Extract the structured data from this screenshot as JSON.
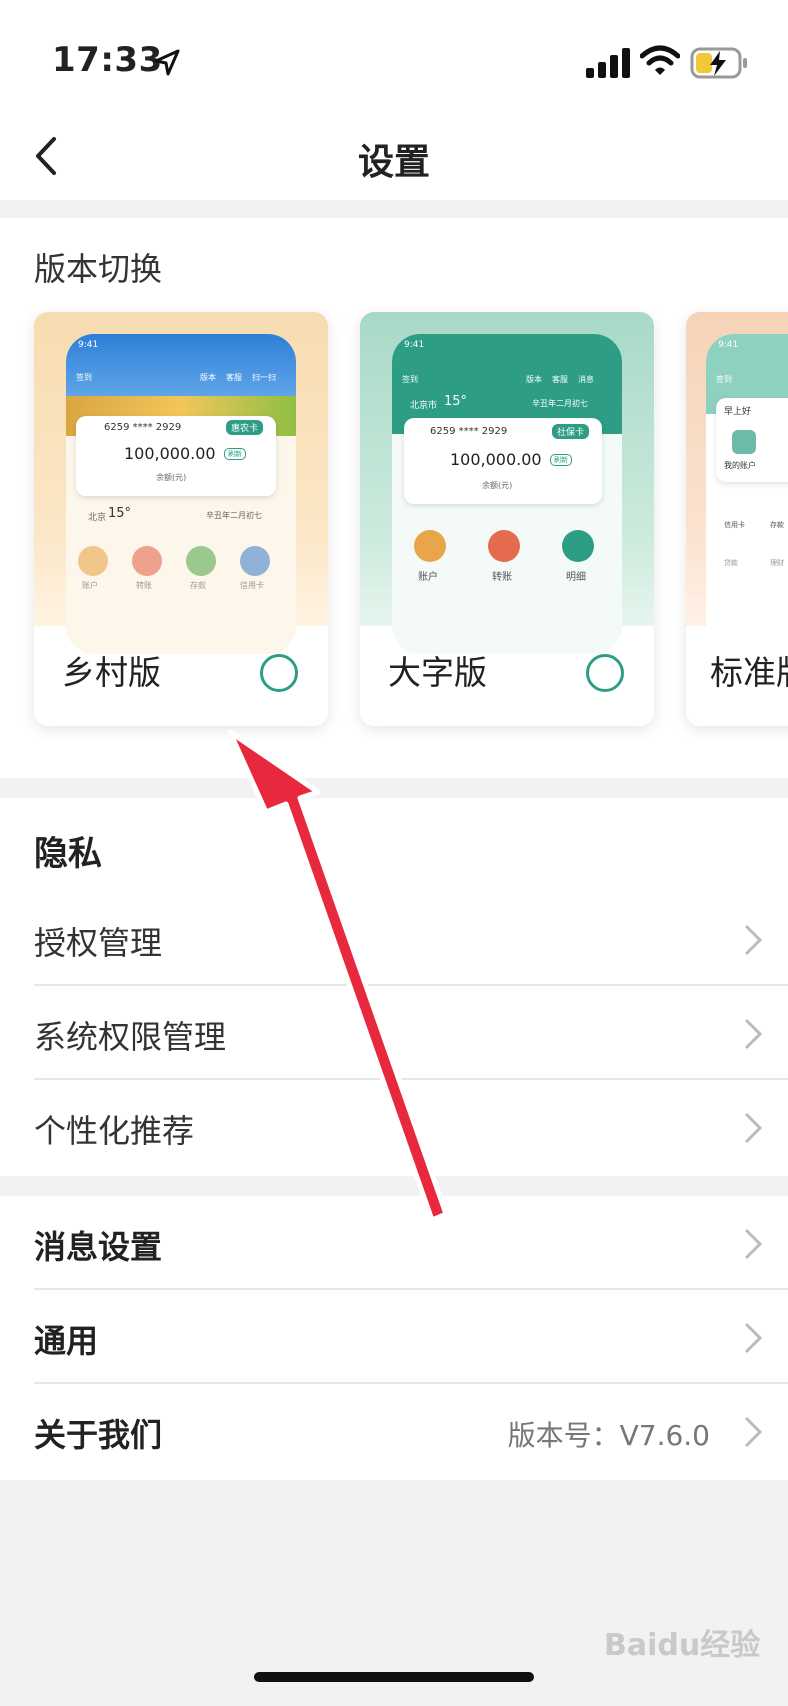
{
  "status_bar": {
    "time": "17:33"
  },
  "nav": {
    "title": "设置"
  },
  "version_switch": {
    "title": "版本切换",
    "cards": [
      {
        "label": "乡村版",
        "preview": {
          "time": "9:41",
          "top_icons": [
            "签到",
            "版本",
            "客服",
            "扫一扫"
          ],
          "card_no": "6259 **** 2929",
          "card_tag": "惠农卡",
          "balance": "100,000.00",
          "refresh": "刷新",
          "balance_label": "余额(元)",
          "city": "北京",
          "temp": "15°",
          "lunar": "辛丑年二月初七",
          "menu": [
            "账户",
            "转账",
            "存款",
            "信用卡"
          ]
        }
      },
      {
        "label": "大字版",
        "preview": {
          "time": "9:41",
          "top_icons": [
            "签到",
            "版本",
            "客服",
            "消息"
          ],
          "city": "北京市",
          "temp": "15°",
          "lunar": "辛丑年二月初七",
          "card_no": "6259 **** 2929",
          "card_tag": "社保卡",
          "balance": "100,000.00",
          "refresh": "刷新",
          "balance_label": "余额(元)",
          "menu": [
            "账户",
            "转账",
            "明细"
          ]
        }
      },
      {
        "label": "标准版",
        "preview": {
          "time": "9:41",
          "top_icons": [
            "签到"
          ],
          "greeting": "早上好",
          "my_account": "我的账户",
          "menu": [
            "信用卡",
            "存款",
            "贷款",
            "理财"
          ]
        }
      }
    ]
  },
  "privacy": {
    "title": "隐私",
    "items": [
      {
        "label": "授权管理"
      },
      {
        "label": "系统权限管理"
      },
      {
        "label": "个性化推荐"
      }
    ]
  },
  "other": {
    "items": [
      {
        "label": "消息设置"
      },
      {
        "label": "通用"
      },
      {
        "label": "关于我们",
        "value": "版本号：V7.6.0"
      }
    ]
  },
  "watermark": "Baidu经验",
  "colors": {
    "accent": "#2d9e85",
    "arrow": "#e8283c"
  }
}
